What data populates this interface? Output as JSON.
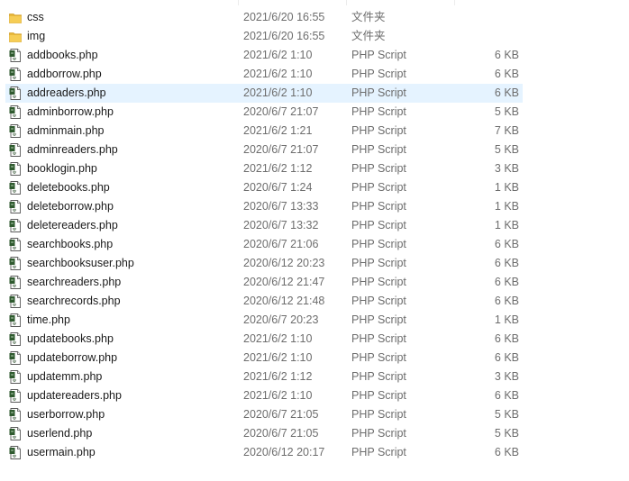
{
  "colors": {
    "selected_row": "#e5f3ff",
    "folder": "#f4c64a",
    "secondary_text": "#6d6d6d"
  },
  "files": [
    {
      "name": "css",
      "date": "2021/6/20 16:55",
      "type": "文件夹",
      "size": "",
      "icon": "folder-icon",
      "selected": false
    },
    {
      "name": "img",
      "date": "2021/6/20 16:55",
      "type": "文件夹",
      "size": "",
      "icon": "folder-icon",
      "selected": false
    },
    {
      "name": "addbooks.php",
      "date": "2021/6/2 1:10",
      "type": "PHP Script",
      "size": "6 KB",
      "icon": "php-script-icon",
      "selected": false
    },
    {
      "name": "addborrow.php",
      "date": "2021/6/2 1:10",
      "type": "PHP Script",
      "size": "6 KB",
      "icon": "php-script-icon",
      "selected": false
    },
    {
      "name": "addreaders.php",
      "date": "2021/6/2 1:10",
      "type": "PHP Script",
      "size": "6 KB",
      "icon": "php-script-icon",
      "selected": true
    },
    {
      "name": "adminborrow.php",
      "date": "2020/6/7 21:07",
      "type": "PHP Script",
      "size": "5 KB",
      "icon": "php-script-icon",
      "selected": false
    },
    {
      "name": "adminmain.php",
      "date": "2021/6/2 1:21",
      "type": "PHP Script",
      "size": "7 KB",
      "icon": "php-script-icon",
      "selected": false
    },
    {
      "name": "adminreaders.php",
      "date": "2020/6/7 21:07",
      "type": "PHP Script",
      "size": "5 KB",
      "icon": "php-script-icon",
      "selected": false
    },
    {
      "name": "booklogin.php",
      "date": "2021/6/2 1:12",
      "type": "PHP Script",
      "size": "3 KB",
      "icon": "php-script-icon",
      "selected": false
    },
    {
      "name": "deletebooks.php",
      "date": "2020/6/7 1:24",
      "type": "PHP Script",
      "size": "1 KB",
      "icon": "php-script-icon",
      "selected": false
    },
    {
      "name": "deleteborrow.php",
      "date": "2020/6/7 13:33",
      "type": "PHP Script",
      "size": "1 KB",
      "icon": "php-script-icon",
      "selected": false
    },
    {
      "name": "deletereaders.php",
      "date": "2020/6/7 13:32",
      "type": "PHP Script",
      "size": "1 KB",
      "icon": "php-script-icon",
      "selected": false
    },
    {
      "name": "searchbooks.php",
      "date": "2020/6/7 21:06",
      "type": "PHP Script",
      "size": "6 KB",
      "icon": "php-script-icon",
      "selected": false
    },
    {
      "name": "searchbooksuser.php",
      "date": "2020/6/12 20:23",
      "type": "PHP Script",
      "size": "6 KB",
      "icon": "php-script-icon",
      "selected": false
    },
    {
      "name": "searchreaders.php",
      "date": "2020/6/12 21:47",
      "type": "PHP Script",
      "size": "6 KB",
      "icon": "php-script-icon",
      "selected": false
    },
    {
      "name": "searchrecords.php",
      "date": "2020/6/12 21:48",
      "type": "PHP Script",
      "size": "6 KB",
      "icon": "php-script-icon",
      "selected": false
    },
    {
      "name": "time.php",
      "date": "2020/6/7 20:23",
      "type": "PHP Script",
      "size": "1 KB",
      "icon": "php-script-icon",
      "selected": false
    },
    {
      "name": "updatebooks.php",
      "date": "2021/6/2 1:10",
      "type": "PHP Script",
      "size": "6 KB",
      "icon": "php-script-icon",
      "selected": false
    },
    {
      "name": "updateborrow.php",
      "date": "2021/6/2 1:10",
      "type": "PHP Script",
      "size": "6 KB",
      "icon": "php-script-icon",
      "selected": false
    },
    {
      "name": "updatemm.php",
      "date": "2021/6/2 1:12",
      "type": "PHP Script",
      "size": "3 KB",
      "icon": "php-script-icon",
      "selected": false
    },
    {
      "name": "updatereaders.php",
      "date": "2021/6/2 1:10",
      "type": "PHP Script",
      "size": "6 KB",
      "icon": "php-script-icon",
      "selected": false
    },
    {
      "name": "userborrow.php",
      "date": "2020/6/7 21:05",
      "type": "PHP Script",
      "size": "5 KB",
      "icon": "php-script-icon",
      "selected": false
    },
    {
      "name": "userlend.php",
      "date": "2020/6/7 21:05",
      "type": "PHP Script",
      "size": "5 KB",
      "icon": "php-script-icon",
      "selected": false
    },
    {
      "name": "usermain.php",
      "date": "2020/6/12 20:17",
      "type": "PHP Script",
      "size": "6 KB",
      "icon": "php-script-icon",
      "selected": false
    }
  ]
}
